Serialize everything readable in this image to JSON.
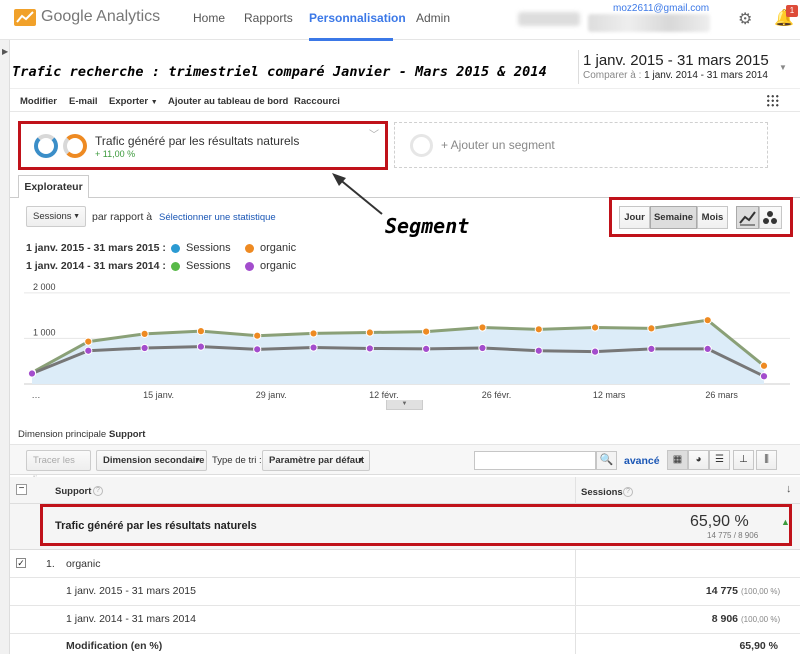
{
  "header": {
    "app_name": "Google Analytics",
    "nav": [
      "Home",
      "Rapports",
      "Personnalisation",
      "Admin"
    ],
    "active_nav": "Personnalisation",
    "account_email": "moz2611@gmail.com",
    "notification_count": "1",
    "icons": [
      "analytics-logo-icon",
      "gear-icon",
      "bell-icon"
    ]
  },
  "report": {
    "title": "Trafic recherche : trimestriel comparé Janvier - Mars 2015 & 2014",
    "date_range": "1 janv. 2015 - 31 mars 2015",
    "compare_label": "Comparer à :",
    "compare_range": "1 janv. 2014 - 31 mars 2014"
  },
  "toolbar": [
    "Modifier",
    "E-mail",
    "Exporter",
    "Ajouter au tableau de bord",
    "Raccourci"
  ],
  "segment": {
    "name": "Trafic généré par les résultats naturels",
    "delta": "+ 11,00 %",
    "add_label": "+ Ajouter un segment"
  },
  "explorer": {
    "tab_label": "Explorateur",
    "metric": "Sessions",
    "vs_label": "par rapport à",
    "select_stat": "Sélectionner une statistique",
    "periods": [
      "Jour",
      "Semaine",
      "Mois"
    ],
    "active_period": "Semaine"
  },
  "annotation": {
    "label": "Segment"
  },
  "legend": [
    {
      "date": "1 janv. 2015 - 31 mars 2015 :",
      "items": [
        {
          "label": "Sessions",
          "color": "#2b9ad2"
        },
        {
          "label": "organic",
          "color": "#ee8a22"
        }
      ]
    },
    {
      "date": "1 janv. 2014 - 31 mars 2014 :",
      "items": [
        {
          "label": "Sessions",
          "color": "#58b948"
        },
        {
          "label": "organic",
          "color": "#a34dcd"
        }
      ]
    }
  ],
  "chart_data": {
    "type": "line",
    "x": [
      "…",
      "15 janv.",
      "29 janv.",
      "12 févr.",
      "26 févr.",
      "12 mars",
      "26 mars"
    ],
    "y_ticks": [
      "2 000",
      "1 000"
    ],
    "ylim": [
      0,
      2000
    ],
    "series": [
      {
        "name": "2015 organic",
        "color": "#ee8a22",
        "values": [
          250,
          930,
          1100,
          1160,
          1060,
          1110,
          1130,
          1150,
          1240,
          1200,
          1240,
          1220,
          1400,
          400
        ]
      },
      {
        "name": "2014 organic",
        "color": "#a34dcd",
        "values": [
          230,
          730,
          790,
          820,
          760,
          800,
          780,
          770,
          790,
          730,
          710,
          770,
          770,
          170
        ]
      }
    ]
  },
  "table": {
    "dimension_label": "Dimension principale :",
    "dimension_value": "Support",
    "plot_rows": "Tracer les lignes",
    "secondary_dim": "Dimension secondaire",
    "sort_label": "Type de tri :",
    "sort_value": "Paramètre par défaut",
    "advanced": "avancé",
    "col_support": "Support",
    "col_sessions": "Sessions",
    "total_label": "Trafic généré par les résultats naturels",
    "total_value": "65,90 %",
    "total_sub": "14 775 / 8 906",
    "row_index": "1.",
    "row_name": "organic",
    "sub_rows": [
      {
        "label": "1 janv. 2015 - 31 mars 2015",
        "value": "14 775",
        "pct": "(100,00 %)"
      },
      {
        "label": "1 janv. 2014 - 31 mars 2014",
        "value": "8 906",
        "pct": "(100,00 %)"
      },
      {
        "label": "Modification (en %)",
        "value": "65,90 %",
        "pct": ""
      }
    ]
  }
}
